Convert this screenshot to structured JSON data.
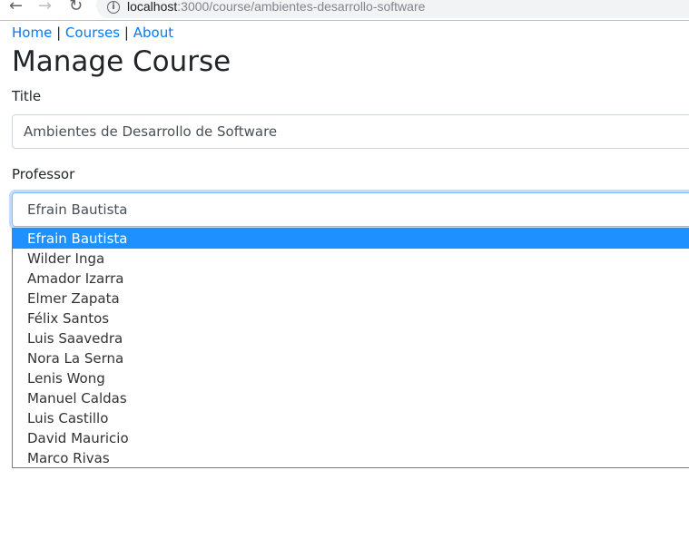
{
  "browser": {
    "url_host": "localhost",
    "url_rest": ":3000/course/ambientes-desarrollo-software"
  },
  "nav": {
    "links": [
      "Home",
      "Courses",
      "About"
    ],
    "separator": "|"
  },
  "page": {
    "title": "Manage Course"
  },
  "form": {
    "title_label": "Title",
    "title_value": "Ambientes de Desarrollo de Software",
    "professor_label": "Professor",
    "professor_value": "Efrain Bautista",
    "professor_options": [
      "Efrain Bautista",
      "Wilder Inga",
      "Amador Izarra",
      "Elmer Zapata",
      "Félix Santos",
      "Luis Saavedra",
      "Nora La Serna",
      "Lenis Wong",
      "Manuel Caldas",
      "Luis Castillo",
      "David Mauricio",
      "Marco Rivas"
    ]
  }
}
